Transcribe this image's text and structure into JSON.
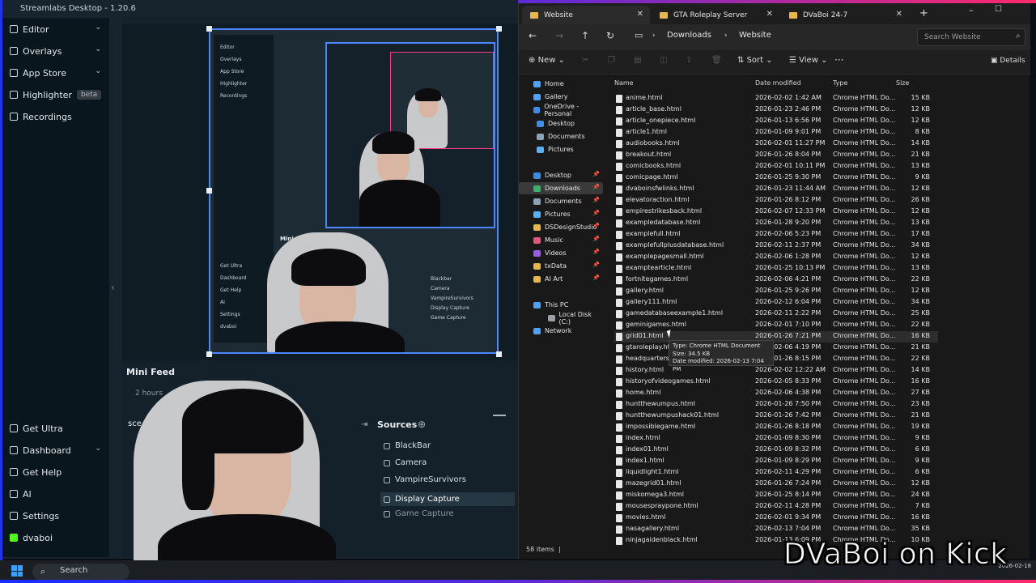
{
  "streamlabs": {
    "title": "Streamlabs Desktop - 1.20.6",
    "sidebar": [
      {
        "label": "Editor",
        "icon": "editor-icon",
        "chevron": "⌄"
      },
      {
        "label": "Overlays",
        "icon": "overlays-icon",
        "chevron": "⌄"
      },
      {
        "label": "App Store",
        "icon": "app-store-icon",
        "chevron": "⌄"
      },
      {
        "label": "Highlighter",
        "icon": "highlighter-icon",
        "badge": "beta"
      },
      {
        "label": "Recordings",
        "icon": "recordings-icon"
      }
    ],
    "sidebar_bottom": [
      {
        "label": "Get Ultra",
        "icon": "ultra-icon"
      },
      {
        "label": "Dashboard",
        "icon": "dashboard-icon",
        "chevron": "⌄"
      },
      {
        "label": "Get Help",
        "icon": "help-icon"
      },
      {
        "label": "AI",
        "icon": "ai-icon"
      },
      {
        "label": "Settings",
        "icon": "gear-icon"
      },
      {
        "label": "dvaboi",
        "icon": "kick-icon"
      }
    ],
    "mini_feed": "Mini Feed",
    "mini_time": "2 hours",
    "scenes_label": "sce",
    "sources_title": "Sources",
    "sources": [
      "BlackBar",
      "Camera",
      "VampireSurvivors",
      "Display Capture",
      "Game Capture"
    ],
    "nested_mini_feed": "Mini Feed",
    "nested_sources": [
      "Blackbar",
      "Camera",
      "VampireSurvivors",
      "Display Capture",
      "Game Capture"
    ],
    "nested_sidebar": [
      "Editor",
      "Overlays",
      "App Store",
      "Highlighter",
      "Recordings",
      "Get Ultra",
      "Dashboard",
      "Get Help",
      "AI",
      "Settings",
      "dvaboi"
    ]
  },
  "explorer": {
    "tabs": [
      "Website",
      "GTA Roleplay Server",
      "DVaBoi 24-7"
    ],
    "breadcrumb": [
      "Downloads",
      "Website"
    ],
    "search_placeholder": "Search Website",
    "toolbar": {
      "new": "New",
      "sort": "Sort",
      "view": "View",
      "details": "Details"
    },
    "nav": [
      {
        "label": "Home",
        "color": "#4aa3ff"
      },
      {
        "label": "Gallery",
        "color": "#4aa3ff"
      },
      {
        "label": "OneDrive - Personal",
        "color": "#3a8ee8"
      },
      {
        "label": "Desktop",
        "color": "#3a8ee8"
      },
      {
        "label": "Documents",
        "color": "#8aa3b8"
      },
      {
        "label": "Pictures",
        "color": "#58b0ff"
      },
      {
        "label": "Desktop",
        "color": "#3a8ee8",
        "pinned": true
      },
      {
        "label": "Downloads",
        "color": "#38b26a",
        "pinned": true,
        "selected": true
      },
      {
        "label": "Documents",
        "color": "#8aa3b8",
        "pinned": true
      },
      {
        "label": "Pictures",
        "color": "#58b0ff",
        "pinned": true
      },
      {
        "label": "DSDesignStudio",
        "color": "#e8b64a",
        "pinned": true
      },
      {
        "label": "Music",
        "color": "#e8557a",
        "pinned": true
      },
      {
        "label": "Videos",
        "color": "#9b5de8",
        "pinned": true
      },
      {
        "label": "txData",
        "color": "#e8b64a",
        "pinned": true
      },
      {
        "label": "AI Art",
        "color": "#e8b64a",
        "pinned": true
      },
      {
        "label": "This PC",
        "color": "#4aa3ff"
      },
      {
        "label": "Local Disk (C:)",
        "color": "#9aa0a6"
      },
      {
        "label": "Network",
        "color": "#4aa3ff"
      }
    ],
    "columns": [
      "Name",
      "Date modified",
      "Type",
      "Size"
    ],
    "files": [
      [
        "anime.html",
        "2026-02-02 1:42 AM",
        "Chrome HTML Do...",
        "15 KB"
      ],
      [
        "article_base.html",
        "2026-01-23 2:46 PM",
        "Chrome HTML Do...",
        "12 KB"
      ],
      [
        "article_onepiece.html",
        "2026-01-13 6:56 PM",
        "Chrome HTML Do...",
        "12 KB"
      ],
      [
        "article1.html",
        "2026-01-09 9:01 PM",
        "Chrome HTML Do...",
        "8 KB"
      ],
      [
        "audiobooks.html",
        "2026-02-01 11:27 PM",
        "Chrome HTML Do...",
        "14 KB"
      ],
      [
        "breakout.html",
        "2026-01-26 8:04 PM",
        "Chrome HTML Do...",
        "21 KB"
      ],
      [
        "comicbooks.html",
        "2026-02-01 10:11 PM",
        "Chrome HTML Do...",
        "13 KB"
      ],
      [
        "comicpage.html",
        "2026-01-25 9:30 PM",
        "Chrome HTML Do...",
        "9 KB"
      ],
      [
        "dvaboinsfwlinks.html",
        "2026-01-23 11:44 AM",
        "Chrome HTML Do...",
        "12 KB"
      ],
      [
        "elevatoraction.html",
        "2026-01-26 8:12 PM",
        "Chrome HTML Do...",
        "26 KB"
      ],
      [
        "empirestrikesback.html",
        "2026-02-07 12:33 PM",
        "Chrome HTML Do...",
        "12 KB"
      ],
      [
        "exampledatabase.html",
        "2026-01-28 9:20 PM",
        "Chrome HTML Do...",
        "13 KB"
      ],
      [
        "examplefull.html",
        "2026-02-06 5:23 PM",
        "Chrome HTML Do...",
        "17 KB"
      ],
      [
        "examplefullplusdatabase.html",
        "2026-02-11 2:37 PM",
        "Chrome HTML Do...",
        "34 KB"
      ],
      [
        "examplepagesmall.html",
        "2026-02-06 1:28 PM",
        "Chrome HTML Do...",
        "12 KB"
      ],
      [
        "examptearticle.html",
        "2026-01-25 10:13 PM",
        "Chrome HTML Do...",
        "13 KB"
      ],
      [
        "fortnitegames.html",
        "2026-02-06 4:21 PM",
        "Chrome HTML Do...",
        "22 KB"
      ],
      [
        "gallery.html",
        "2026-01-25 9:26 PM",
        "Chrome HTML Do...",
        "12 KB"
      ],
      [
        "gallery111.html",
        "2026-02-12 6:04 PM",
        "Chrome HTML Do...",
        "34 KB"
      ],
      [
        "gamedatabaseexample1.html",
        "2026-02-11 2:22 PM",
        "Chrome HTML Do...",
        "25 KB"
      ],
      [
        "geminigames.html",
        "2026-02-01 7:10 PM",
        "Chrome HTML Do...",
        "22 KB"
      ],
      [
        "grid01.html",
        "2026-01-26 7:21 PM",
        "Chrome HTML Do...",
        "16 KB"
      ],
      [
        "gtaroleplay.html",
        "2026-02-06 4:19 PM",
        "Chrome HTML Do...",
        "21 KB"
      ],
      [
        "headquarters.html",
        "2026-01-26 8:15 PM",
        "Chrome HTML Do...",
        "22 KB"
      ],
      [
        "history.html",
        "2026-02-02 12:22 AM",
        "Chrome HTML Do...",
        "14 KB"
      ],
      [
        "historyofvideogames.html",
        "2026-02-05 8:33 PM",
        "Chrome HTML Do...",
        "16 KB"
      ],
      [
        "home.html",
        "2026-02-06 4:38 PM",
        "Chrome HTML Do...",
        "27 KB"
      ],
      [
        "huntthewumpus.html",
        "2026-01-26 7:50 PM",
        "Chrome HTML Do...",
        "23 KB"
      ],
      [
        "huntthewumpushack01.html",
        "2026-01-26 7:42 PM",
        "Chrome HTML Do...",
        "21 KB"
      ],
      [
        "impossiblegame.html",
        "2026-01-26 8:18 PM",
        "Chrome HTML Do...",
        "19 KB"
      ],
      [
        "index.html",
        "2026-01-09 8:30 PM",
        "Chrome HTML Do...",
        "9 KB"
      ],
      [
        "index01.html",
        "2026-01-09 8:32 PM",
        "Chrome HTML Do...",
        "6 KB"
      ],
      [
        "index1.html",
        "2026-01-09 8:29 PM",
        "Chrome HTML Do...",
        "9 KB"
      ],
      [
        "liquidlight1.html",
        "2026-02-11 4:29 PM",
        "Chrome HTML Do...",
        "6 KB"
      ],
      [
        "mazegrid01.html",
        "2026-01-26 7:24 PM",
        "Chrome HTML Do...",
        "12 KB"
      ],
      [
        "miskomega3.html",
        "2026-01-25 8:14 PM",
        "Chrome HTML Do...",
        "24 KB"
      ],
      [
        "mousespraypone.html",
        "2026-02-11 4:28 PM",
        "Chrome HTML Do...",
        "7 KB"
      ],
      [
        "movies.html",
        "2026-02-01 9:34 PM",
        "Chrome HTML Do...",
        "16 KB"
      ],
      [
        "nasagallery.html",
        "2026-02-13 7:04 PM",
        "Chrome HTML Do...",
        "35 KB"
      ],
      [
        "ninjagaidenblack.html",
        "2026-01-13 6:09 PM",
        "Chrome HTML Do...",
        "10 KB"
      ]
    ],
    "hover_row": 21,
    "tooltip": [
      "Type: Chrome HTML Document",
      "Size: 34.5 KB",
      "Date modified: 2026-02-13 7:04 PM"
    ],
    "status": "58 items"
  },
  "taskbar": {
    "search": "Search",
    "date": "2026-02-18"
  },
  "brand": "DVaBoi on Kick"
}
